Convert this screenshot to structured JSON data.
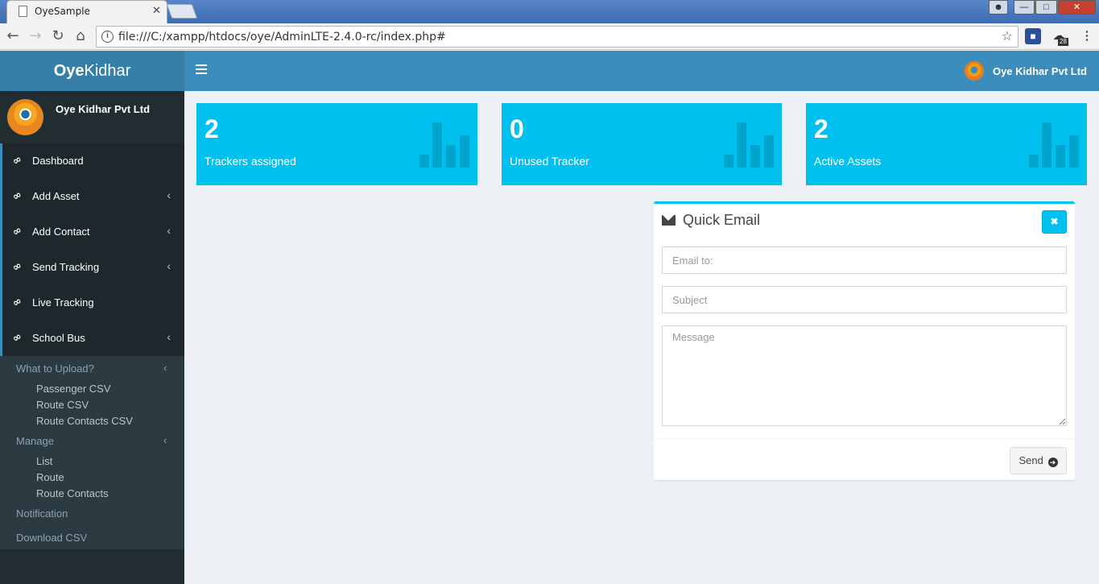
{
  "browser": {
    "tab_title": "OyeSample",
    "tab_close": "✕",
    "url": "file:///C:/xampp/htdocs/oye/AdminLTE-2.4.0-rc/index.php#",
    "ext_badge": "28"
  },
  "header": {
    "logo_bold": "Oye",
    "logo_rest": "Kidhar",
    "company": "Oye Kidhar Pvt Ltd"
  },
  "sidebar": {
    "user_name": "Oye Kidhar Pvt Ltd",
    "items": [
      {
        "label": "Dashboard",
        "has_children": false
      },
      {
        "label": "Add Asset",
        "has_children": true
      },
      {
        "label": "Add Contact",
        "has_children": true
      },
      {
        "label": "Send Tracking",
        "has_children": true
      },
      {
        "label": "Live Tracking",
        "has_children": false
      },
      {
        "label": "School Bus",
        "has_children": true
      }
    ],
    "submenu": {
      "upload_header": "What to Upload?",
      "upload_items": [
        "Passenger CSV",
        "Route CSV",
        "Route Contacts CSV"
      ],
      "manage_header": "Manage",
      "manage_items": [
        "List",
        "Route",
        "Route Contacts"
      ],
      "notification": "Notification",
      "download": "Download CSV"
    }
  },
  "stats": [
    {
      "value": "2",
      "label": "Trackers assigned"
    },
    {
      "value": "0",
      "label": "Unused Tracker"
    },
    {
      "value": "2",
      "label": "Active Assets"
    }
  ],
  "quick_email": {
    "title": "Quick Email",
    "email_placeholder": "Email to:",
    "subject_placeholder": "Subject",
    "message_placeholder": "Message",
    "send_label": "Send"
  },
  "colors": {
    "header": "#3c8dbc",
    "logo_bg": "#367fa9",
    "sidebar": "#222d32",
    "info_box": "#00c0ef",
    "content_bg": "#ecf0f5"
  }
}
